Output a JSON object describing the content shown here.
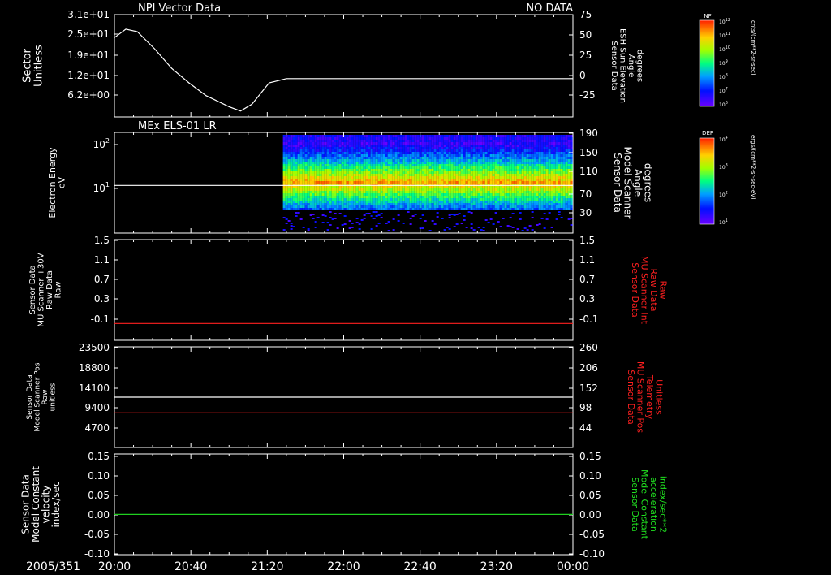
{
  "header": {
    "title": "NPI Vector Data",
    "status": "NO DATA"
  },
  "time_axis": {
    "date_label": "2005/351",
    "ticks": [
      "20:00",
      "20:40",
      "21:20",
      "22:00",
      "22:40",
      "23:20",
      "00:00"
    ],
    "range_hours": [
      20,
      24
    ]
  },
  "colorbars": [
    {
      "title": "NF",
      "units": "cnts/(cm**2-sr-sec)",
      "exponents": [
        "12",
        "11",
        "10",
        "9",
        "8",
        "7",
        "6"
      ],
      "base": "10"
    },
    {
      "title": "DEF",
      "units": "ergs/(cm**2-sr-sec-eV)",
      "exponents": [
        "4",
        "3",
        "2",
        "1"
      ],
      "base": "10"
    }
  ],
  "chart_data": [
    {
      "type": "line",
      "panel": "sector",
      "left_label": [
        "Sector",
        "Unitless"
      ],
      "left_ticks": [
        "3.1e+01",
        "2.5e+01",
        "1.9e+01",
        "1.2e+01",
        "6.2e+00"
      ],
      "right_label": [
        "Sensor Data",
        "ESH Sun Elevation",
        "Angle",
        "degrees"
      ],
      "right_ticks": [
        "75",
        "50",
        "25",
        "0",
        "-25"
      ],
      "right_ylim": [
        -45,
        75
      ],
      "series": [
        {
          "color": "#ffffff",
          "x_hours": [
            20.0,
            20.1,
            20.2,
            20.35,
            20.5,
            20.65,
            20.8,
            21.0,
            21.1,
            21.2,
            21.35,
            21.5,
            22.0,
            23.0,
            24.0
          ],
          "y": [
            48,
            58,
            55,
            35,
            12,
            -5,
            -20,
            -33,
            -38,
            -30,
            -5,
            0,
            0,
            0,
            0
          ]
        }
      ]
    },
    {
      "type": "heatmap",
      "panel": "electron-energy",
      "title": "MEx ELS-01 LR",
      "left_label": [
        "Electron Energy",
        "eV"
      ],
      "left_ticks": [
        "10",
        "10"
      ],
      "left_tick_exponents": [
        "2",
        "1"
      ],
      "right_label": [
        "Sensor Data",
        "Model Scanner",
        "Angle",
        "degrees"
      ],
      "right_ticks": [
        "190",
        "150",
        "110",
        "70",
        "30"
      ],
      "right_ylim": [
        0,
        190
      ],
      "data_start_hour": 21.47,
      "series": [
        {
          "color": "#ffffff",
          "x_hours": [
            20.0,
            24.0
          ],
          "y": [
            90,
            90
          ]
        }
      ]
    },
    {
      "type": "line",
      "panel": "mu-scanner-raw",
      "left_label": [
        "Sensor Data",
        "MU Scanner +30V",
        "Raw Data",
        "Raw"
      ],
      "left_ticks": [
        "1.5",
        "1.1",
        "0.7",
        "0.3",
        "-0.1"
      ],
      "right_label": [
        "Sensor Data",
        "MU Scanner Int",
        "Raw Data",
        "Raw"
      ],
      "right_ticks": [
        "1.5",
        "1.1",
        "0.7",
        "0.3",
        "-0.1"
      ],
      "ylim": [
        -0.3,
        1.5
      ],
      "series": [
        {
          "color": "#ff2020",
          "x_hours": [
            20.0,
            24.0
          ],
          "y": [
            0.0,
            0.0
          ]
        }
      ]
    },
    {
      "type": "line",
      "panel": "scanner-pos",
      "left_label": [
        "Sensor Data",
        "Model Scanner Pos",
        "Raw",
        "unitless"
      ],
      "left_ticks": [
        "23500",
        "18800",
        "14100",
        "9400",
        "4700"
      ],
      "right_label": [
        "Sensor Data",
        "MU Scanner Pos",
        "Telemetry",
        "Unitless"
      ],
      "right_ticks": [
        "260",
        "206",
        "152",
        "98",
        "44"
      ],
      "ylim": [
        0,
        23500
      ],
      "series": [
        {
          "color": "#ffffff",
          "x_hours": [
            20.0,
            24.0
          ],
          "y": [
            11750,
            11750
          ]
        },
        {
          "color": "#ff2020",
          "x_hours": [
            20.0,
            24.0
          ],
          "y": [
            8100,
            8100
          ]
        }
      ]
    },
    {
      "type": "line",
      "panel": "constant-velocity",
      "left_label": [
        "Sensor Data",
        "Model Constant",
        "velocity",
        "index/sec"
      ],
      "left_ticks": [
        "0.15",
        "0.10",
        "0.05",
        "0.00",
        "-0.05",
        "-0.10"
      ],
      "right_label": [
        "Sensor Data",
        "Model Constant",
        "acceleration",
        "index/sec**2"
      ],
      "right_ticks": [
        "0.15",
        "0.10",
        "0.05",
        "0.00",
        "-0.05",
        "-0.10"
      ],
      "ylim": [
        -0.1,
        0.15
      ],
      "series": [
        {
          "color": "#20d020",
          "x_hours": [
            20.0,
            24.0
          ],
          "y": [
            0.0,
            0.0
          ]
        }
      ]
    }
  ],
  "colors": {
    "foreground": "#ffffff",
    "red_axis": "#ff2020",
    "green_axis": "#20e020"
  }
}
